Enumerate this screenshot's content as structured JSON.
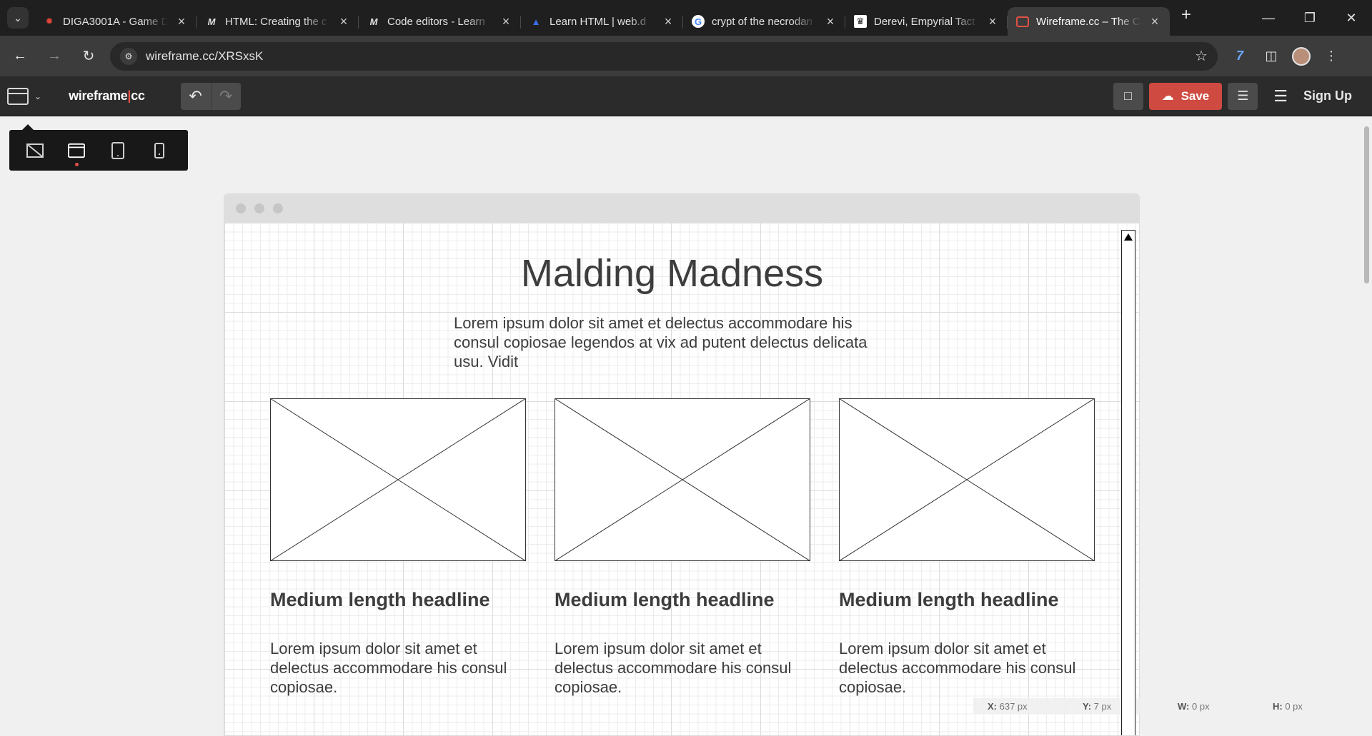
{
  "browser": {
    "tabs": [
      {
        "title": "DIGA3001A - Game D",
        "icon": "diga-favicon",
        "active": false
      },
      {
        "title": "HTML: Creating the c",
        "icon": "mdn-favicon",
        "active": false
      },
      {
        "title": "Code editors - Learn",
        "icon": "mdn-favicon",
        "active": false
      },
      {
        "title": "Learn HTML  |  web.d",
        "icon": "webdev-favicon",
        "active": false
      },
      {
        "title": "crypt of the necrodan",
        "icon": "google-favicon",
        "active": false
      },
      {
        "title": "Derevi, Empyrial Tact",
        "icon": "scryfall-favicon",
        "active": false
      },
      {
        "title": "Wireframe.cc – The C",
        "icon": "wireframe-favicon",
        "active": true
      }
    ],
    "url": "wireframe.cc/XRSxsK"
  },
  "app": {
    "brand_main": "wireframe",
    "brand_sep": "|",
    "brand_suffix": "cc",
    "save_label": "Save",
    "signup_label": "Sign Up"
  },
  "wireframe": {
    "title": "Malding Madness",
    "intro": "Lorem ipsum dolor sit amet et delectus accommodare his consul copiosae legendos at vix ad putent delectus delicata usu. Vidit",
    "columns": [
      {
        "headline": "Medium length headline",
        "body": "Lorem ipsum dolor sit amet et delectus accommodare his consul copiosae."
      },
      {
        "headline": "Medium length headline",
        "body": "Lorem ipsum dolor sit amet et delectus accommodare his consul copiosae."
      },
      {
        "headline": "Medium length headline",
        "body": "Lorem ipsum dolor sit amet et delectus accommodare his consul copiosae."
      }
    ]
  },
  "coords": {
    "x_label": "X:",
    "x_value": "637 px",
    "y_label": "Y:",
    "y_value": "7 px",
    "w_label": "W:",
    "w_value": "0 px",
    "h_label": "H:",
    "h_value": "0 px"
  },
  "colors": {
    "accent": "#cf4a40",
    "app_bar": "#2b2b2b"
  }
}
